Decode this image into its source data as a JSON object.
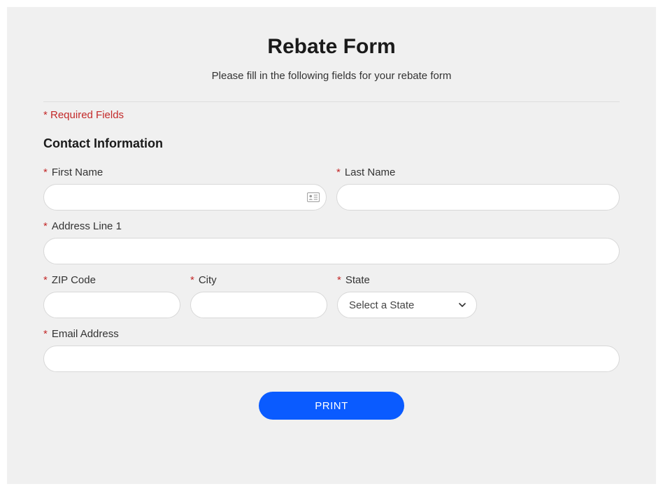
{
  "header": {
    "title": "Rebate Form",
    "subtitle": "Please fill in the following fields for your rebate form"
  },
  "required_note": "* Required Fields",
  "section_heading": "Contact Information",
  "fields": {
    "first_name": {
      "label": "First Name",
      "value": ""
    },
    "last_name": {
      "label": "Last Name",
      "value": ""
    },
    "address1": {
      "label": "Address Line 1",
      "value": ""
    },
    "zip": {
      "label": "ZIP Code",
      "value": ""
    },
    "city": {
      "label": "City",
      "value": ""
    },
    "state": {
      "label": "State",
      "placeholder": "Select a State",
      "value": ""
    },
    "email": {
      "label": "Email Address",
      "value": ""
    }
  },
  "buttons": {
    "print": "PRINT"
  },
  "symbols": {
    "asterisk": "*"
  }
}
